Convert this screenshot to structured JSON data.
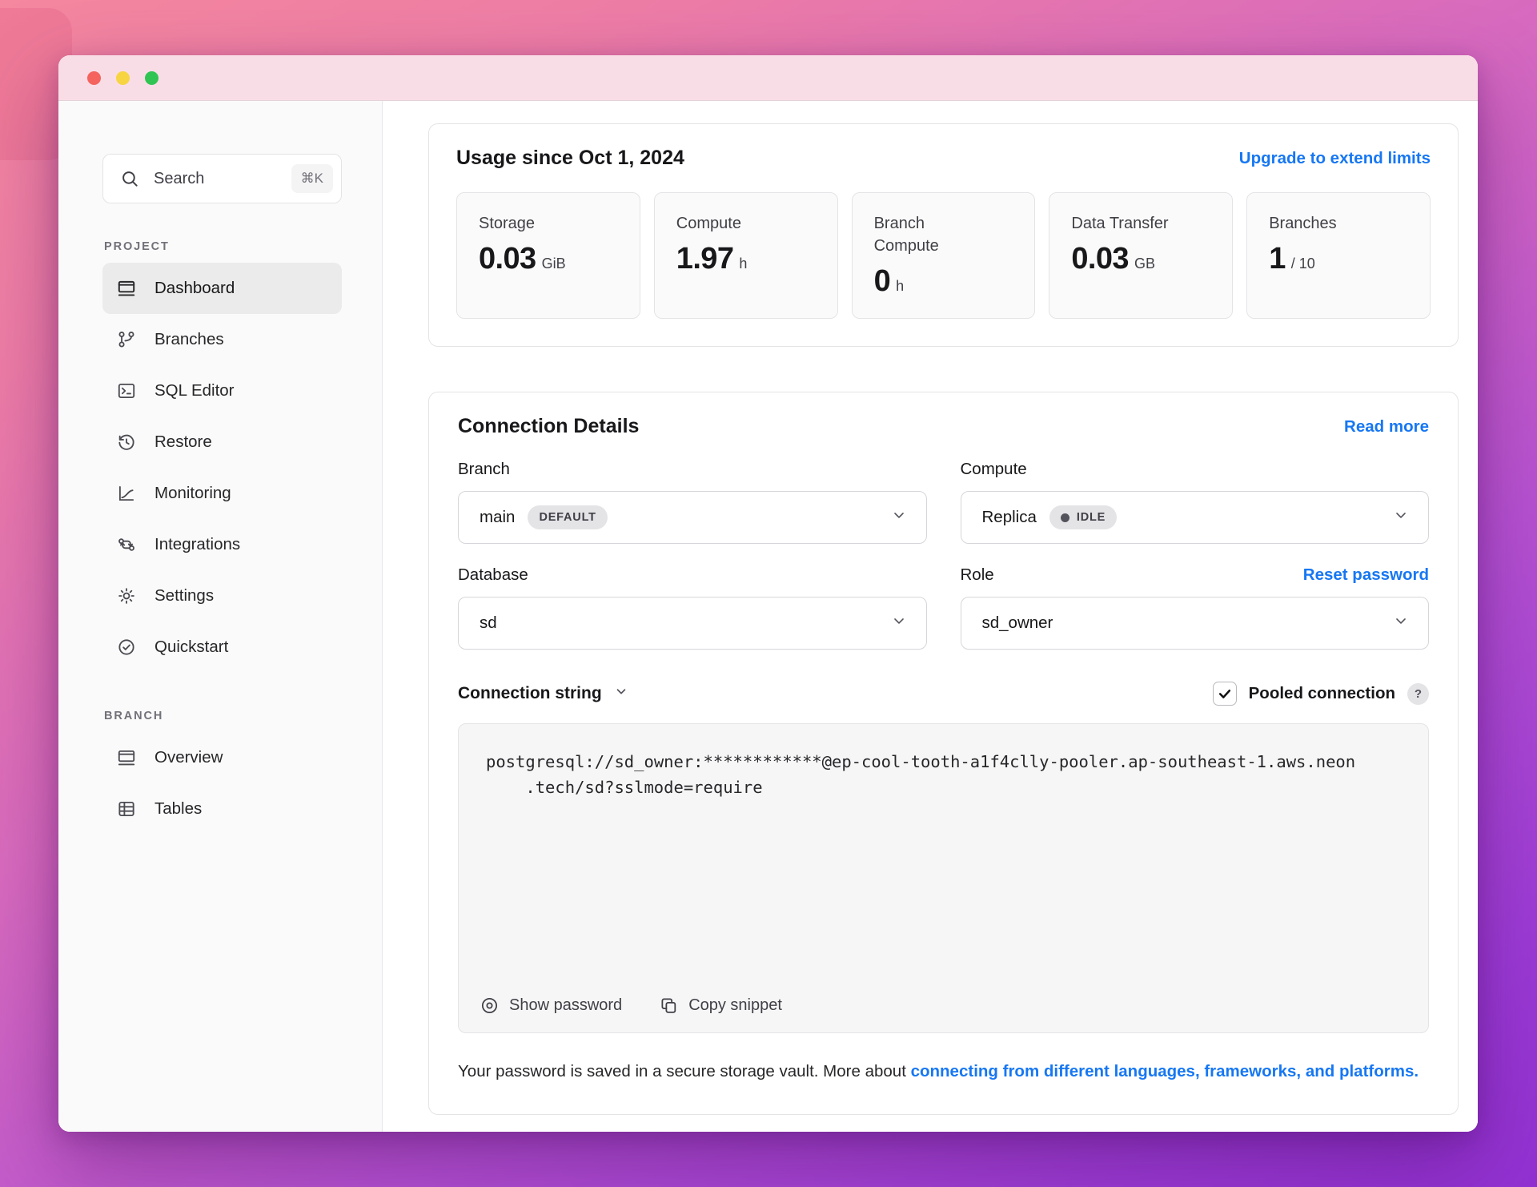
{
  "window": {
    "traffic_lights": {
      "close": "close",
      "minimize": "minimize",
      "zoom": "zoom"
    }
  },
  "sidebar": {
    "search": {
      "label": "Search",
      "shortcut": "⌘K"
    },
    "sections": [
      {
        "title": "PROJECT",
        "items": [
          {
            "label": "Dashboard",
            "icon": "dashboard-icon",
            "active": true
          },
          {
            "label": "Branches",
            "icon": "branches-icon",
            "active": false
          },
          {
            "label": "SQL Editor",
            "icon": "sql-editor-icon",
            "active": false
          },
          {
            "label": "Restore",
            "icon": "restore-icon",
            "active": false
          },
          {
            "label": "Monitoring",
            "icon": "monitoring-icon",
            "active": false
          },
          {
            "label": "Integrations",
            "icon": "integrations-icon",
            "active": false
          },
          {
            "label": "Settings",
            "icon": "settings-icon",
            "active": false
          },
          {
            "label": "Quickstart",
            "icon": "quickstart-icon",
            "active": false
          }
        ]
      },
      {
        "title": "BRANCH",
        "items": [
          {
            "label": "Overview",
            "icon": "overview-icon",
            "active": false
          },
          {
            "label": "Tables",
            "icon": "tables-icon",
            "active": false
          }
        ]
      }
    ]
  },
  "usage": {
    "title": "Usage since Oct 1, 2024",
    "upgrade_link": "Upgrade to extend limits",
    "cards": [
      {
        "label": "Storage",
        "value": "0.03",
        "unit": "GiB"
      },
      {
        "label": "Compute",
        "value": "1.97",
        "unit": "h"
      },
      {
        "label": "Branch Compute",
        "value": "0",
        "unit": "h"
      },
      {
        "label": "Data Transfer",
        "value": "0.03",
        "unit": "GB"
      },
      {
        "label": "Branches",
        "value": "1",
        "unit": "/ 10"
      }
    ]
  },
  "connection": {
    "title": "Connection Details",
    "read_more": "Read more",
    "branch": {
      "label": "Branch",
      "value": "main",
      "badge": "DEFAULT"
    },
    "compute": {
      "label": "Compute",
      "value": "Replica",
      "badge": "IDLE"
    },
    "database": {
      "label": "Database",
      "value": "sd"
    },
    "role": {
      "label": "Role",
      "value": "sd_owner",
      "reset_link": "Reset password"
    },
    "string_selector": {
      "label": "Connection string"
    },
    "pooled": {
      "label": "Pooled connection",
      "checked": true,
      "help": "?"
    },
    "code": {
      "line1": "postgresql://sd_owner:************@ep-cool-tooth-a1f4clly-pooler.ap-southeast-1.aws.neon",
      "line2": ".tech/sd?sslmode=require"
    },
    "actions": {
      "show_password": "Show password",
      "copy_snippet": "Copy snippet"
    },
    "footer": {
      "text": "Your password is saved in a secure storage vault. More about ",
      "link": "connecting from different languages, frameworks, and platforms."
    }
  },
  "colors": {
    "accent_blue": "#1677f3",
    "titlebar_pink": "#f9dde6",
    "sidebar_bg": "#fafafa",
    "card_bg": "#fafafa",
    "badge_bg": "#e4e4e7",
    "gradient_top": "#f5879f",
    "gradient_bottom": "#9231d2",
    "traffic_red": "#f4635e",
    "traffic_yellow": "#f7d441",
    "traffic_green": "#30c553"
  }
}
